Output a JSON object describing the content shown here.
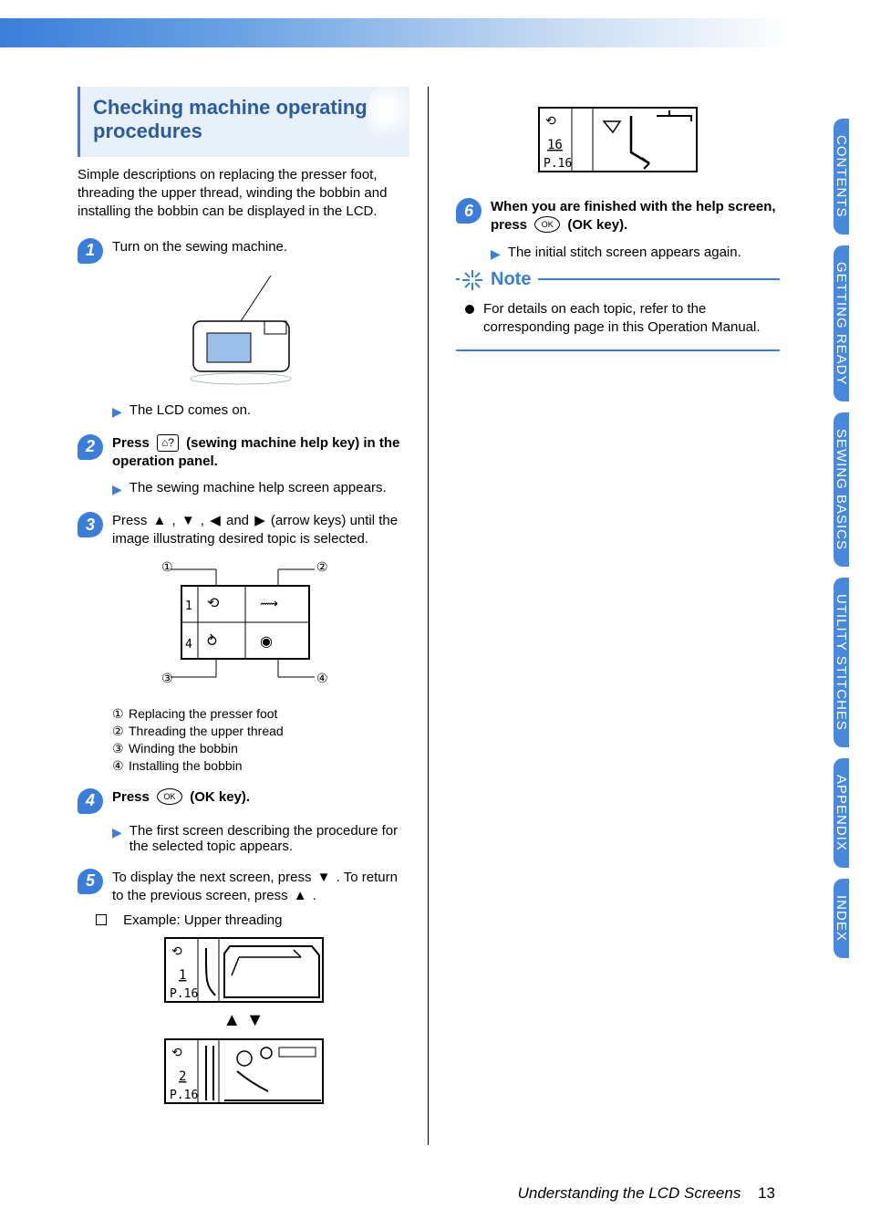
{
  "header": {
    "title": "Checking machine operating procedures"
  },
  "intro": "Simple descriptions on replacing the presser foot, threading the upper thread, winding the bobbin and installing the bobbin can be displayed in the LCD.",
  "steps": {
    "s1": {
      "text": "Turn on the sewing machine."
    },
    "s1_result": "The LCD comes on.",
    "s2_a": "Press ",
    "s2_b": " (sewing machine help key) in the operation panel.",
    "s2_result": "The sewing machine help screen appears.",
    "s3_a": "Press ",
    "s3_b": " ,  ",
    "s3_c": " ,  ",
    "s3_d": "  and  ",
    "s3_e": "  (arrow keys) until the image illustrating desired topic is selected.",
    "s3_list": {
      "i1": "Replacing the presser foot",
      "i2": "Threading the upper thread",
      "i3": "Winding the bobbin",
      "i4": "Installing the bobbin"
    },
    "s4_a": "Press ",
    "s4_b": " (OK key).",
    "s4_result": "The first screen describing the procedure for the selected topic appears.",
    "s5_a": "To display the next screen, press ",
    "s5_b": " . To return to the previous screen, press ",
    "s5_c": " .",
    "s5_example": "Example: Upper threading",
    "s6_a": "When you are finished with the help screen, press ",
    "s6_b": " (OK key).",
    "s6_result": "The initial stitch screen appears again."
  },
  "note": {
    "title": "Note",
    "body": "For details on each topic, refer to the corresponding page in this Operation Manual."
  },
  "tabs": [
    "CONTENTS",
    "GETTING READY",
    "SEWING BASICS",
    "UTILITY STITCHES",
    "APPENDIX",
    "INDEX"
  ],
  "footer": {
    "section": "Understanding the LCD Screens",
    "page": "13"
  },
  "lcd": {
    "s3_1": "1",
    "s3_4": "4",
    "ex1_a": "1",
    "ex1_b": "P.16",
    "ex2_a": "2",
    "ex2_b": "P.16",
    "ex3_a": "16",
    "ex3_b": "P.16"
  }
}
